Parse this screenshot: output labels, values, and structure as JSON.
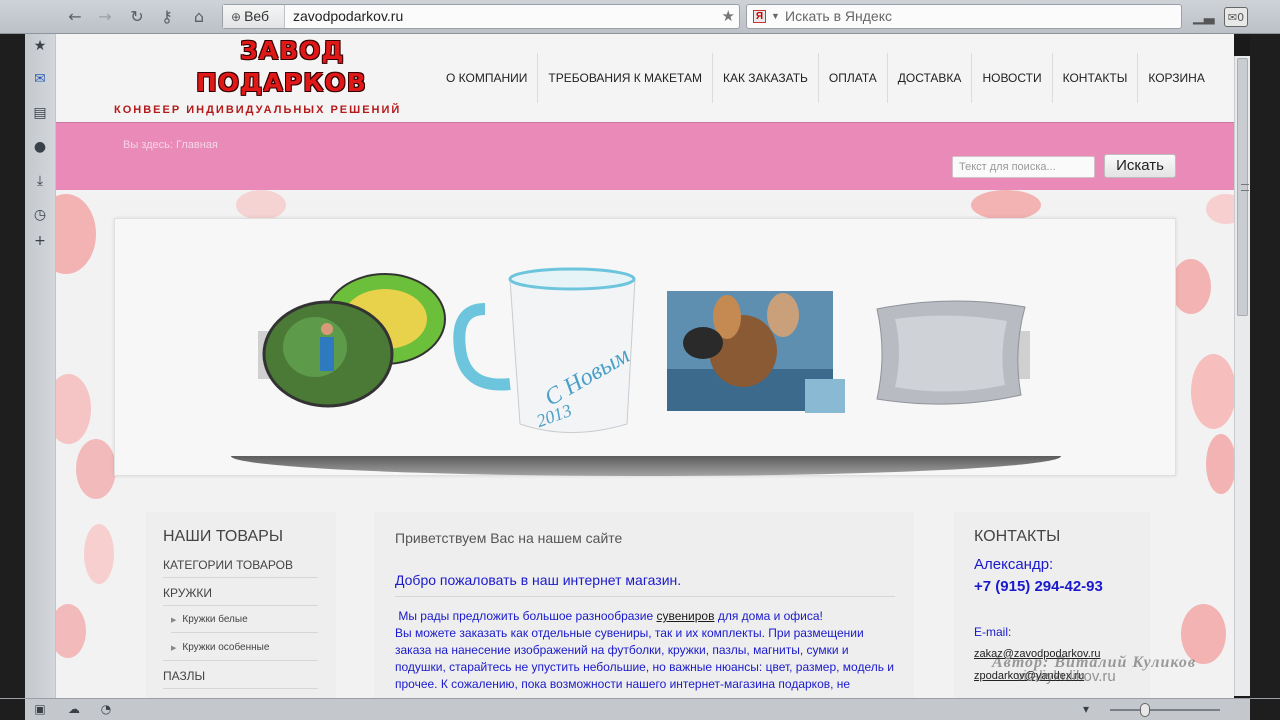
{
  "browser": {
    "web_tag": "Веб",
    "url": "zavodpodarkov.ru",
    "search_placeholder": "Искать в Яндекс"
  },
  "site": {
    "logo_line1": "ЗАВОД",
    "logo_line2": "ПОДАРКОВ",
    "logo_tagline": "КОНВЕЕР ИНДИВИДУАЛЬНЫХ РЕШЕНИЙ",
    "menu": [
      "О КОМПАНИИ",
      "ТРЕБОВАНИЯ К МАКЕТАМ",
      "КАК ЗАКАЗАТЬ",
      "ОПЛАТА",
      "ДОСТАВКА",
      "НОВОСТИ",
      "КОНТАКТЫ",
      "КОРЗИНА"
    ],
    "breadcrumb_prefix": "Вы здесь:",
    "breadcrumb_page": "Главная",
    "search_placeholder": "Текст для поиска...",
    "search_button": "Искать"
  },
  "products": {
    "heading": "НАШИ ТОВАРЫ",
    "categories_label": "КАТЕГОРИИ ТОВАРОВ",
    "cat_mugs": "КРУЖКИ",
    "sub_white": "Кружки белые",
    "sub_special": "Кружки особенные",
    "cat_puzzles": "ПАЗЛЫ"
  },
  "main": {
    "greeting": "Приветствуем Вас на нашем сайте",
    "welcome": "Добро пожаловать в наш интернет магазин.",
    "p1_before": "Мы рады предложить большое разнообразие ",
    "p1_link": "сувениров",
    "p1_after": " для дома и офиса!",
    "p2": "Вы можете заказать как отдельные сувениры, так и их комплекты.  При размещении заказа на нанесение изображений на футболки, кружки, пазлы, магниты, сумки и подушки, старайтесь не упустить небольшие, но важные нюансы: цвет, размер, модель и прочее. К сожалению,  пока возможности нашего интернет-магазина подарков, не"
  },
  "contacts": {
    "heading": "КОНТАКТЫ",
    "name": "Александр:",
    "phone": "+7 (915) 294-42-93",
    "email_label": "E-mail:",
    "email1": "zakaz@zavodpodarkov.ru",
    "email2": "zpodarkov@yandex.ru"
  },
  "watermark": {
    "author": "Автор: Виталий Куликов",
    "site": "vitaliykulikov.ru"
  },
  "colors": {
    "pink_bar": "#e98ab8",
    "logo_red": "#e01818",
    "link_blue": "#1a1acc"
  }
}
